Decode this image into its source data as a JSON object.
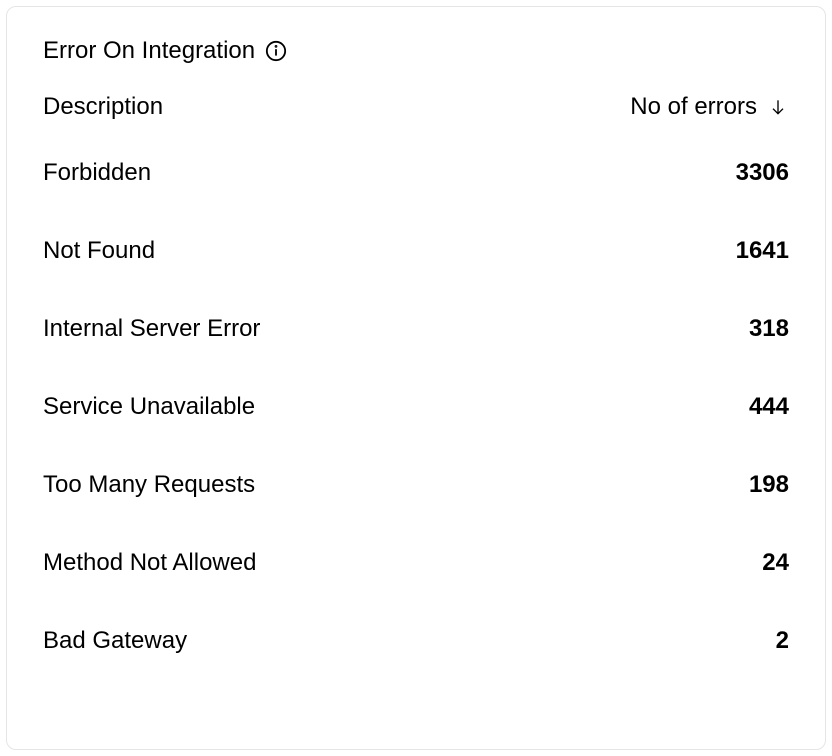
{
  "card": {
    "title": "Error On Integration"
  },
  "columns": {
    "description": "Description",
    "count": "No of errors"
  },
  "rows": [
    {
      "description": "Forbidden",
      "count": "3306"
    },
    {
      "description": "Not Found",
      "count": "1641"
    },
    {
      "description": "Internal Server Error",
      "count": "318"
    },
    {
      "description": "Service Unavailable",
      "count": "444"
    },
    {
      "description": "Too Many Requests",
      "count": "198"
    },
    {
      "description": "Method Not Allowed",
      "count": "24"
    },
    {
      "description": "Bad Gateway",
      "count": "2"
    }
  ]
}
